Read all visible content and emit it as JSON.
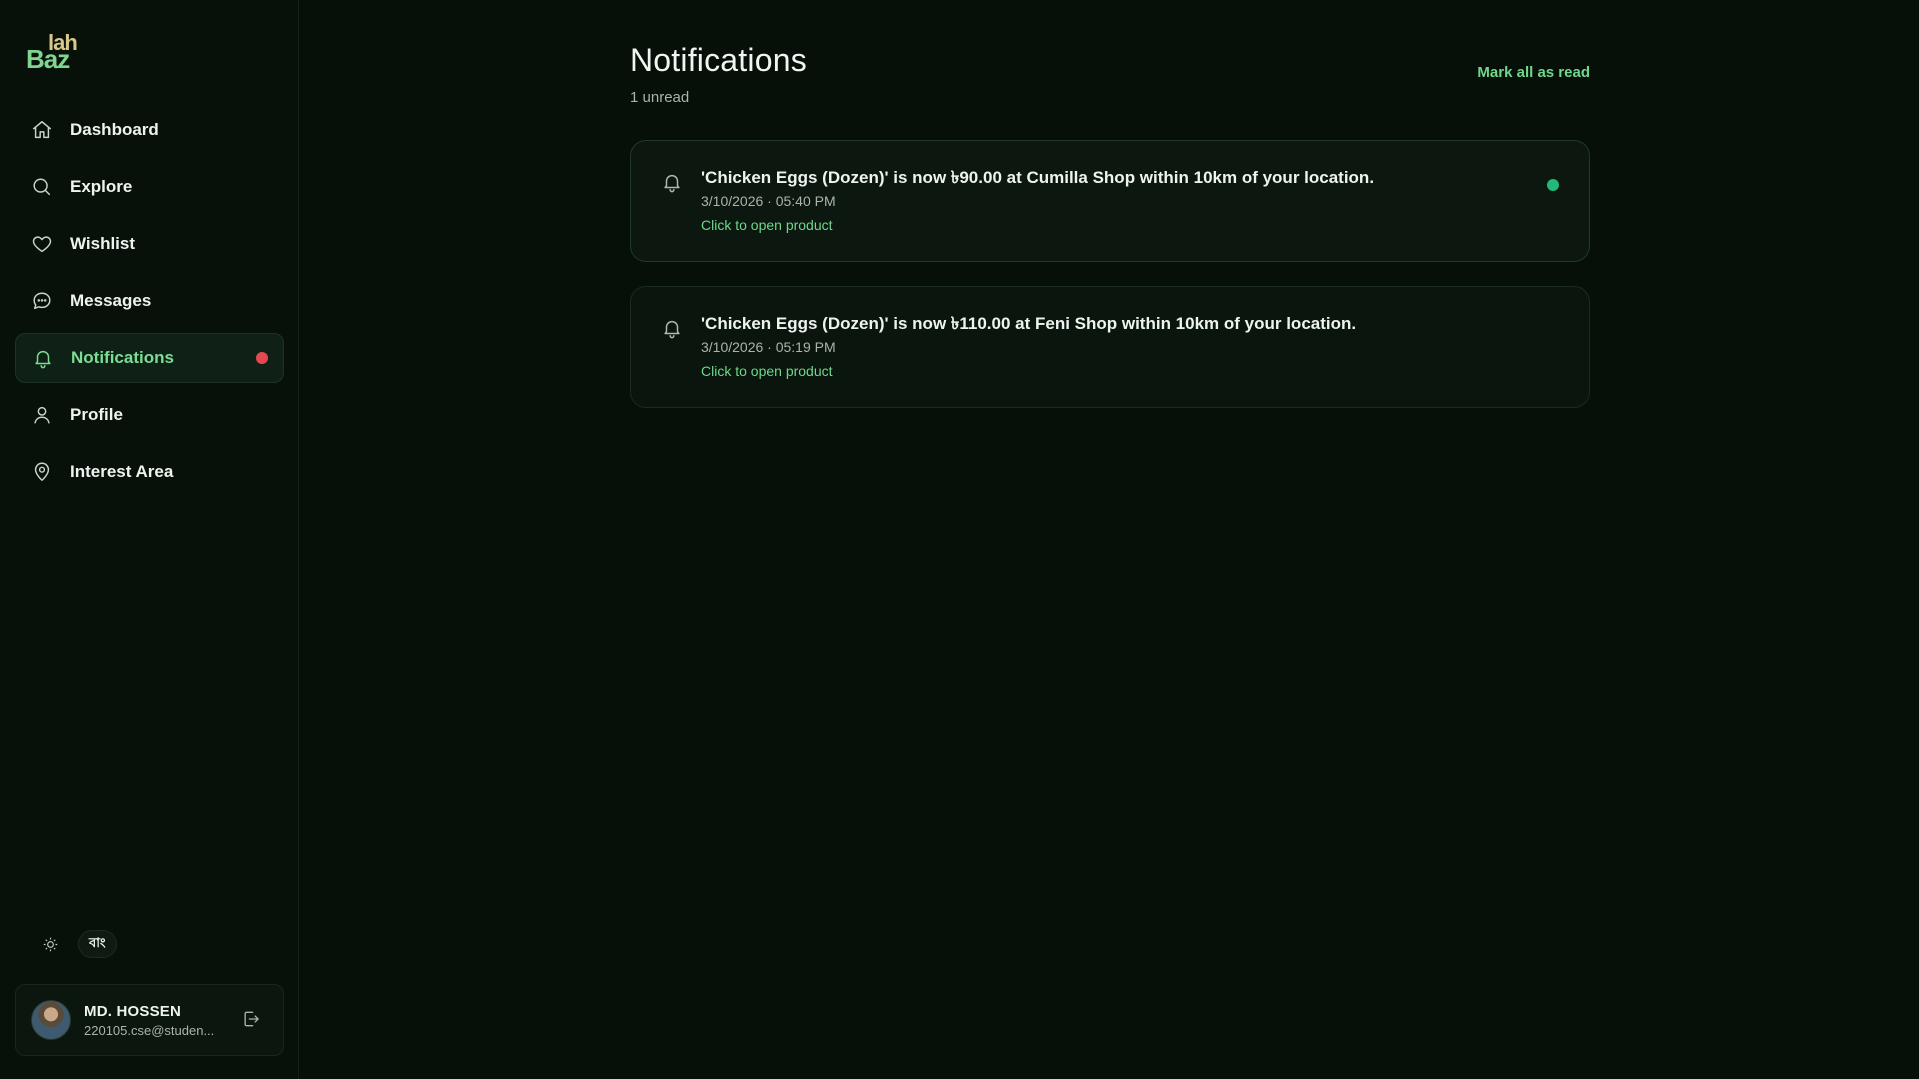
{
  "brand": {
    "logo_part1": "Baz",
    "logo_part2": "lah"
  },
  "sidebar": {
    "items": [
      {
        "label": "Dashboard",
        "icon": "home-icon"
      },
      {
        "label": "Explore",
        "icon": "search-icon"
      },
      {
        "label": "Wishlist",
        "icon": "heart-icon"
      },
      {
        "label": "Messages",
        "icon": "chat-icon"
      },
      {
        "label": "Notifications",
        "icon": "bell-icon",
        "active": true,
        "has_badge": true
      },
      {
        "label": "Profile",
        "icon": "user-icon"
      },
      {
        "label": "Interest Area",
        "icon": "map-pin-icon"
      }
    ],
    "language_label": "বাং"
  },
  "user": {
    "name": "MD. HOSSEN",
    "email": "220105.cse@studen..."
  },
  "page": {
    "title": "Notifications",
    "unread_summary": "1 unread",
    "mark_all_label": "Mark all as read"
  },
  "notifications": [
    {
      "message": "'Chicken Eggs (Dozen)' is now ৳90.00 at Cumilla Shop within 10km of your location.",
      "time": "3/10/2026 · 05:40 PM",
      "link_label": "Click to open product",
      "unread": true
    },
    {
      "message": "'Chicken Eggs (Dozen)' is now ৳110.00 at Feni Shop within 10km of your location.",
      "time": "3/10/2026 · 05:19 PM",
      "link_label": "Click to open product",
      "unread": false
    }
  ],
  "colors": {
    "accent": "#6fd88c",
    "badge_red": "#e5484d",
    "unread_dot": "#22b877",
    "background": "#061009"
  }
}
